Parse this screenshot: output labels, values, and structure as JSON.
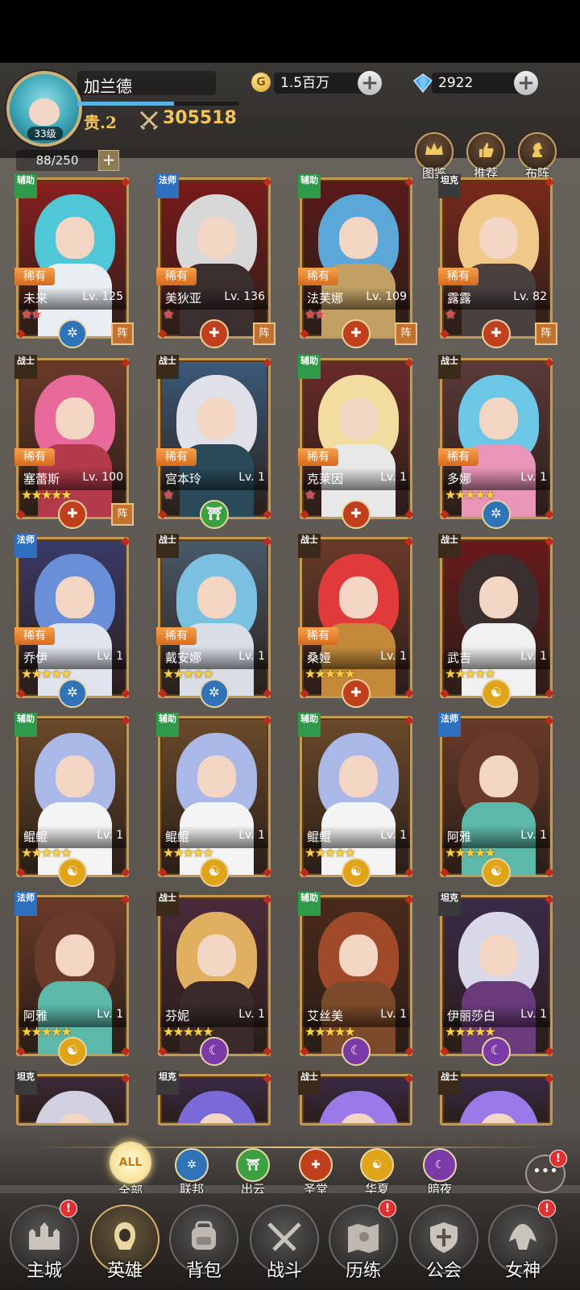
{
  "player": {
    "name": "加兰德",
    "level": "33级",
    "vip": "贵.2",
    "power": "305518",
    "exp_fraction": 0.6
  },
  "resources": {
    "gold": "1.5百万",
    "gems": "2922"
  },
  "hero_count": "88/250",
  "top_buttons": [
    {
      "label": "图鉴",
      "icon": "crown-icon"
    },
    {
      "label": "推荐",
      "icon": "thumbs-up-icon"
    },
    {
      "label": "布阵",
      "icon": "knight-icon"
    }
  ],
  "heroes": [
    {
      "role": "辅助",
      "rarity": "稀有",
      "name": "未来",
      "level": "Lv. 125",
      "stars": 2,
      "star_color": "red",
      "faction": "联邦",
      "in_formation": true,
      "formation_label": "阵",
      "hair": "#4fc7d6",
      "body": "#e9eef2",
      "bg": "#8b1f1f"
    },
    {
      "role": "法师",
      "rarity": "稀有",
      "name": "美狄亚",
      "level": "Lv. 136",
      "stars": 1,
      "star_color": "red",
      "faction": "圣堂",
      "in_formation": true,
      "formation_label": "阵",
      "hair": "#d8d8d8",
      "body": "#3a2e2e",
      "bg": "#7a1a1a"
    },
    {
      "role": "辅助",
      "rarity": "稀有",
      "name": "法芙娜",
      "level": "Lv. 109",
      "stars": 2,
      "star_color": "red",
      "faction": "圣堂",
      "in_formation": true,
      "formation_label": "阵",
      "hair": "#5aa7d8",
      "body": "#c2a064",
      "bg": "#5b1a1a"
    },
    {
      "role": "坦克",
      "rarity": "稀有",
      "name": "露露",
      "level": "Lv. 82",
      "stars": 1,
      "star_color": "red",
      "faction": "圣堂",
      "in_formation": true,
      "formation_label": "阵",
      "hair": "#f0c98a",
      "body": "#4a4040",
      "bg": "#7a2a1a"
    },
    {
      "role": "战士",
      "rarity": "稀有",
      "name": "塞蕾斯",
      "level": "Lv. 100",
      "stars": 5,
      "star_color": "gold",
      "faction": "圣堂",
      "in_formation": true,
      "formation_label": "阵",
      "hair": "#e86a9a",
      "body": "#b23a4a",
      "bg": "#6a3a2a"
    },
    {
      "role": "战士",
      "rarity": "稀有",
      "name": "宫本玲",
      "level": "Lv. 1",
      "stars": 1,
      "star_color": "red",
      "faction": "出云",
      "in_formation": false,
      "formation_label": "",
      "hair": "#e0e0e8",
      "body": "#2a4a5a",
      "bg": "#3a5a7a"
    },
    {
      "role": "辅助",
      "rarity": "稀有",
      "name": "克莱因",
      "level": "Lv. 1",
      "stars": 1,
      "star_color": "red",
      "faction": "圣堂",
      "in_formation": false,
      "formation_label": "",
      "hair": "#f3dca0",
      "body": "#e8e8e8",
      "bg": "#6a2a2a"
    },
    {
      "role": "战士",
      "rarity": "稀有",
      "name": "多娜",
      "level": "Lv. 1",
      "stars": 5,
      "star_color": "gold",
      "faction": "联邦",
      "in_formation": false,
      "formation_label": "",
      "hair": "#6cc6e6",
      "body": "#e996b8",
      "bg": "#5a3a3a"
    },
    {
      "role": "法师",
      "rarity": "稀有",
      "name": "乔伊",
      "level": "Lv. 1",
      "stars": 5,
      "star_color": "gold",
      "faction": "联邦",
      "in_formation": false,
      "formation_label": "",
      "hair": "#6a8fd8",
      "body": "#e0e4ee",
      "bg": "#3a3a6a"
    },
    {
      "role": "战士",
      "rarity": "稀有",
      "name": "戴安娜",
      "level": "Lv. 1",
      "stars": 5,
      "star_color": "gold",
      "faction": "联邦",
      "in_formation": false,
      "formation_label": "",
      "hair": "#7ac0e0",
      "body": "#d8dde6",
      "bg": "#4a5a6a"
    },
    {
      "role": "战士",
      "rarity": "稀有",
      "name": "桑娅",
      "level": "Lv. 1",
      "stars": 5,
      "star_color": "gold",
      "faction": "圣堂",
      "in_formation": false,
      "formation_label": "",
      "hair": "#e03a3a",
      "body": "#c48a3a",
      "bg": "#6a3a2a"
    },
    {
      "role": "战士",
      "rarity": "",
      "name": "武吉",
      "level": "Lv. 1",
      "stars": 5,
      "star_color": "gold",
      "faction": "华夏",
      "in_formation": false,
      "formation_label": "",
      "hair": "#3a2e2e",
      "body": "#f0f0f0",
      "bg": "#6a1a1a"
    },
    {
      "role": "辅助",
      "rarity": "",
      "name": "鲲鲲",
      "level": "Lv. 1",
      "stars": 5,
      "star_color": "gold",
      "faction": "华夏",
      "in_formation": false,
      "formation_label": "",
      "hair": "#aab8e8",
      "body": "#f4f4f4",
      "bg": "#6a4a2a"
    },
    {
      "role": "辅助",
      "rarity": "",
      "name": "鲲鲲",
      "level": "Lv. 1",
      "stars": 5,
      "star_color": "gold",
      "faction": "华夏",
      "in_formation": false,
      "formation_label": "",
      "hair": "#aab8e8",
      "body": "#f4f4f4",
      "bg": "#6a4a2a"
    },
    {
      "role": "辅助",
      "rarity": "",
      "name": "鲲鲲",
      "level": "Lv. 1",
      "stars": 5,
      "star_color": "gold",
      "faction": "华夏",
      "in_formation": false,
      "formation_label": "",
      "hair": "#aab8e8",
      "body": "#f4f4f4",
      "bg": "#6a4a2a"
    },
    {
      "role": "法师",
      "rarity": "",
      "name": "阿雅",
      "level": "Lv. 1",
      "stars": 5,
      "star_color": "gold",
      "faction": "华夏",
      "in_formation": false,
      "formation_label": "",
      "hair": "#6a3a2a",
      "body": "#5cb8a8",
      "bg": "#6a3a2a"
    },
    {
      "role": "法师",
      "rarity": "",
      "name": "阿雅",
      "level": "Lv. 1",
      "stars": 5,
      "star_color": "gold",
      "faction": "华夏",
      "in_formation": false,
      "formation_label": "",
      "hair": "#6a3a2a",
      "body": "#5cb8a8",
      "bg": "#6a3a2a"
    },
    {
      "role": "战士",
      "rarity": "",
      "name": "芬妮",
      "level": "Lv. 1",
      "stars": 5,
      "star_color": "gold",
      "faction": "暗夜",
      "in_formation": false,
      "formation_label": "",
      "hair": "#e0b060",
      "body": "#3a2a2a",
      "bg": "#4a2a3a"
    },
    {
      "role": "辅助",
      "rarity": "",
      "name": "艾丝美",
      "level": "Lv. 1",
      "stars": 5,
      "star_color": "gold",
      "faction": "暗夜",
      "in_formation": false,
      "formation_label": "",
      "hair": "#a04a2a",
      "body": "#7a4a2a",
      "bg": "#4a2a1a"
    },
    {
      "role": "坦克",
      "rarity": "",
      "name": "伊丽莎白",
      "level": "Lv. 1",
      "stars": 5,
      "star_color": "gold",
      "faction": "暗夜",
      "in_formation": false,
      "formation_label": "",
      "hair": "#d8d8e8",
      "body": "#6a3a7a",
      "bg": "#3a2a4a"
    },
    {
      "role": "坦克",
      "rarity": "",
      "name": "",
      "level": "",
      "stars": 0,
      "star_color": "gold",
      "faction": "",
      "in_formation": false,
      "formation_label": "",
      "hair": "#d0d0e0",
      "body": "#4a3a5a",
      "bg": "#3a2a3a"
    },
    {
      "role": "坦克",
      "rarity": "",
      "name": "",
      "level": "",
      "stars": 0,
      "star_color": "gold",
      "faction": "",
      "in_formation": false,
      "formation_label": "",
      "hair": "#7a6ad8",
      "body": "#4a3a6a",
      "bg": "#3a2a4a"
    },
    {
      "role": "战士",
      "rarity": "",
      "name": "",
      "level": "",
      "stars": 0,
      "star_color": "gold",
      "faction": "",
      "in_formation": false,
      "formation_label": "",
      "hair": "#9a7ae8",
      "body": "#4a3a6a",
      "bg": "#3a2a4a"
    },
    {
      "role": "战士",
      "rarity": "",
      "name": "",
      "level": "",
      "stars": 0,
      "star_color": "gold",
      "faction": "",
      "in_formation": false,
      "formation_label": "",
      "hair": "#9a7ae8",
      "body": "#4a3a6a",
      "bg": "#3a2a4a"
    }
  ],
  "factions": [
    {
      "key": "all",
      "label": "全部",
      "icon_text": "ALL",
      "color": "#f6d774"
    },
    {
      "key": "federation",
      "label": "联邦",
      "icon_text": "✲",
      "color": "#2f73b8"
    },
    {
      "key": "izumo",
      "label": "出云",
      "icon_text": "⛩",
      "color": "#3aa040"
    },
    {
      "key": "sanctuary",
      "label": "圣堂",
      "icon_text": "✚",
      "color": "#c0401e"
    },
    {
      "key": "huaxia",
      "label": "华夏",
      "icon_text": "☯",
      "color": "#e0a418"
    },
    {
      "key": "night",
      "label": "暗夜",
      "icon_text": "☾",
      "color": "#7a3aa8"
    }
  ],
  "faction_colors": {
    "联邦": "#2f73b8",
    "出云": "#3aa040",
    "圣堂": "#c0401e",
    "华夏": "#e0a418",
    "暗夜": "#7a3aa8"
  },
  "faction_glyphs": {
    "联邦": "✲",
    "出云": "⛩",
    "圣堂": "✚",
    "华夏": "☯",
    "暗夜": "☾"
  },
  "role_colors": {
    "辅助": "#2e9a4a",
    "法师": "#2e6fc0",
    "坦克": "#3a3a3a",
    "战士": "#3a2a1a"
  },
  "bottom_nav": [
    {
      "label": "主城",
      "icon": "castle-icon",
      "badge": true
    },
    {
      "label": "英雄",
      "icon": "hero-icon",
      "badge": false,
      "active": true
    },
    {
      "label": "背包",
      "icon": "backpack-icon",
      "badge": false
    },
    {
      "label": "战斗",
      "icon": "swords-icon",
      "badge": false
    },
    {
      "label": "历练",
      "icon": "map-icon",
      "badge": true
    },
    {
      "label": "公会",
      "icon": "guild-shield-icon",
      "badge": false
    },
    {
      "label": "女神",
      "icon": "goddess-icon",
      "badge": true
    }
  ],
  "chat_badge": "!"
}
